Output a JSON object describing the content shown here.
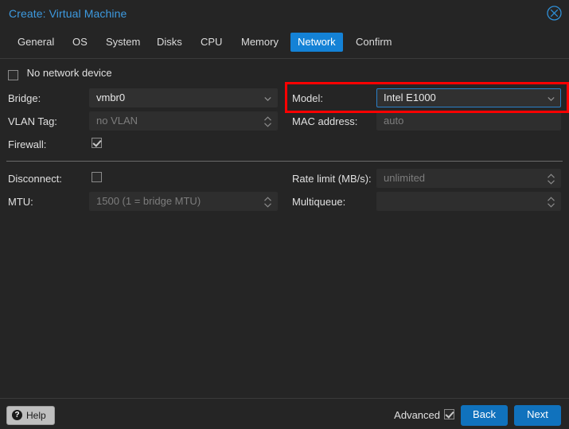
{
  "window": {
    "title": "Create: Virtual Machine",
    "close_icon": "close-circle-icon",
    "accent_blue": "#1482d6",
    "title_blue": "#3d9ae0",
    "background": "#252525",
    "highlight_color": "#ff0000"
  },
  "tabs": [
    {
      "label": "General",
      "active": false
    },
    {
      "label": "OS",
      "active": false
    },
    {
      "label": "System",
      "active": false
    },
    {
      "label": "Disks",
      "active": false
    },
    {
      "label": "CPU",
      "active": false
    },
    {
      "label": "Memory",
      "active": false
    },
    {
      "label": "Network",
      "active": true
    },
    {
      "label": "Confirm",
      "active": false
    }
  ],
  "form": {
    "no_network_device": {
      "label": "No network device",
      "checked": false
    },
    "left": {
      "bridge": {
        "label": "Bridge:",
        "value": "vmbr0",
        "placeholder": "",
        "control": "combobox",
        "icon": "chevron-down-icon"
      },
      "vlan_tag": {
        "label": "VLAN Tag:",
        "value": "",
        "placeholder": "no VLAN",
        "control": "spinner",
        "icon": "spinner-arrows-icon"
      },
      "firewall": {
        "label": "Firewall:",
        "checked": true
      },
      "disconnect": {
        "label": "Disconnect:",
        "checked": false
      },
      "mtu": {
        "label": "MTU:",
        "value": "",
        "placeholder": "1500 (1 = bridge MTU)",
        "control": "spinner",
        "icon": "spinner-arrows-icon"
      }
    },
    "right": {
      "model": {
        "label": "Model:",
        "value": "Intel E1000",
        "placeholder": "",
        "control": "combobox",
        "icon": "chevron-down-icon",
        "focused": true,
        "highlighted": true
      },
      "mac_address": {
        "label": "MAC address:",
        "value": "",
        "placeholder": "auto",
        "control": "textfield"
      },
      "rate_limit": {
        "label": "Rate limit (MB/s):",
        "value": "",
        "placeholder": "unlimited",
        "control": "spinner",
        "icon": "spinner-arrows-icon"
      },
      "multiqueue": {
        "label": "Multiqueue:",
        "value": "",
        "placeholder": "",
        "control": "spinner",
        "icon": "spinner-arrows-icon"
      }
    }
  },
  "footer": {
    "help_label": "Help",
    "help_icon": "question-mark-icon",
    "advanced_label": "Advanced",
    "advanced_checked": true,
    "back_label": "Back",
    "next_label": "Next"
  }
}
